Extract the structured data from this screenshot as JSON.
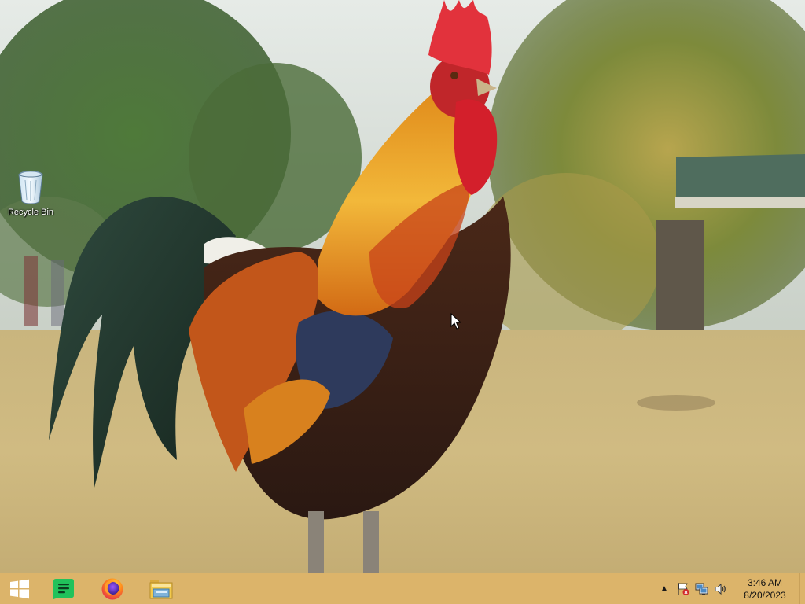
{
  "desktop": {
    "icons": [
      {
        "label": "Recycle Bin",
        "icon": "recycle-bin-icon"
      }
    ]
  },
  "taskbar": {
    "color": "#dcb46a",
    "start": {
      "icon": "windows-logo-icon"
    },
    "pinned": [
      {
        "name": "notes-app",
        "icon": "notes-icon",
        "color": "#21c25b"
      },
      {
        "name": "firefox",
        "icon": "firefox-icon",
        "color": "#ff7a1a"
      },
      {
        "name": "file-explorer",
        "icon": "folder-icon",
        "color": "#f2c94c"
      }
    ],
    "tray": {
      "icons": [
        "chevron-up-icon",
        "action-center-flag-icon",
        "network-icon",
        "volume-icon"
      ],
      "time": "3:46 AM",
      "date": "8/20/2023"
    }
  }
}
